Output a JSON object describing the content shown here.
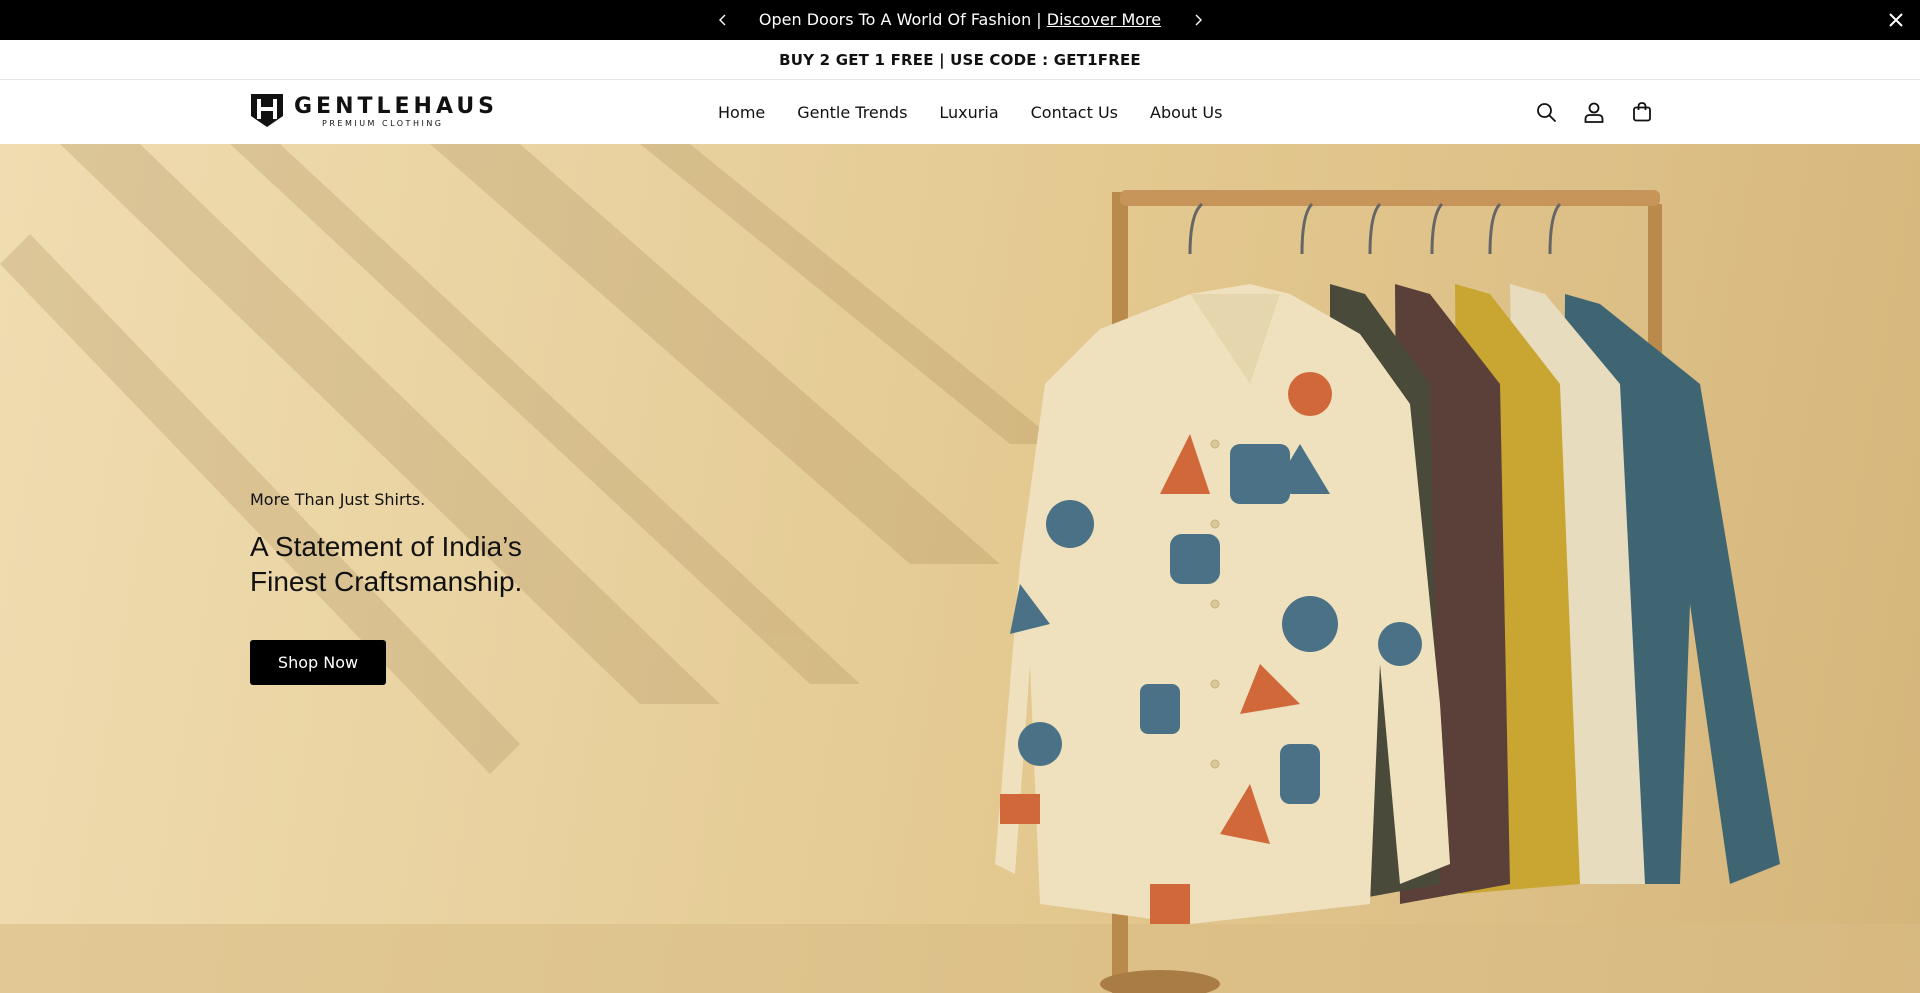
{
  "announcement": {
    "text": "Open Doors To A World Of Fashion |",
    "link_text": "Discover More"
  },
  "promo": {
    "text": "BUY 2 GET 1 FREE | USE CODE : GET1FREE"
  },
  "header": {
    "logo_brand": "GENTLEHAUS",
    "logo_sub": "PREMIUM CLOTHING",
    "nav": [
      "Home",
      "Gentle Trends",
      "Luxuria",
      "Contact Us",
      "About Us"
    ],
    "icons": [
      "search-icon",
      "account-icon",
      "cart-icon"
    ]
  },
  "hero": {
    "eyebrow": "More Than Just Shirts.",
    "headline_line1": "A Statement of India’s",
    "headline_line2": "Finest Craftsmanship.",
    "cta": "Shop Now"
  },
  "colors": {
    "announcement_bg": "#000000",
    "hero_bg": "#e9d2a0",
    "button_bg": "#000000"
  }
}
